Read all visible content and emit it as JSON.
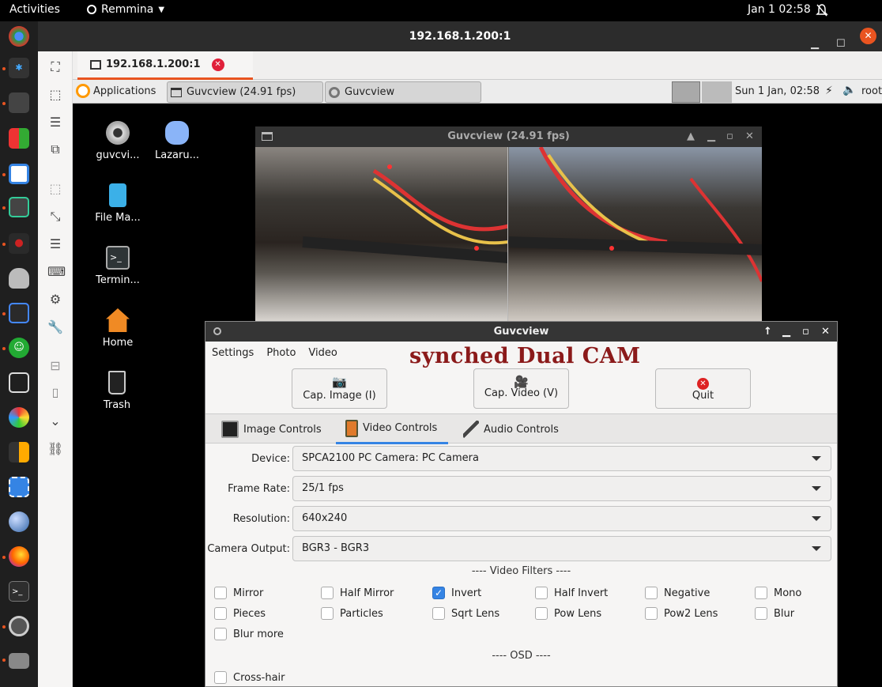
{
  "topbar": {
    "activities": "Activities",
    "app_name": "Remmina",
    "clock": "Jan 1  02:58"
  },
  "remmina": {
    "window_title": "192.168.1.200:1",
    "tab_label": "192.168.1.200:1"
  },
  "xpanel": {
    "applications": "Applications",
    "task1": "Guvcview  (24.91 fps)",
    "task2": "Guvcview",
    "clock": "Sun  1 Jan, 02:58",
    "user": "root"
  },
  "desktop_icons": [
    {
      "label": "guvcvi..."
    },
    {
      "label": "Lazaru..."
    },
    {
      "label": "File Ma..."
    },
    {
      "label": "Termin..."
    },
    {
      "label": "Home"
    },
    {
      "label": "Trash"
    }
  ],
  "video_window": {
    "title": "Guvcview  (24.91 fps)"
  },
  "guvcview": {
    "title": "Guvcview",
    "menu": [
      "Settings",
      "Photo",
      "Video"
    ],
    "overlay_text": "synched Dual CAM",
    "buttons": {
      "cap_image": "Cap. Image (I)",
      "cap_video": "Cap. Video (V)",
      "quit": "Quit"
    },
    "tabs": [
      "Image Controls",
      "Video Controls",
      "Audio Controls"
    ],
    "fields": [
      {
        "label": "Device:",
        "value": "SPCA2100 PC Camera: PC Camera"
      },
      {
        "label": "Frame Rate:",
        "value": "25/1 fps"
      },
      {
        "label": "Resolution:",
        "value": "640x240"
      },
      {
        "label": "Camera Output:",
        "value": "BGR3 - BGR3"
      }
    ],
    "video_filters_header": "---- Video Filters ----",
    "filters": [
      {
        "label": "Mirror",
        "checked": false
      },
      {
        "label": "Half Mirror",
        "checked": false
      },
      {
        "label": "Invert",
        "checked": true
      },
      {
        "label": "Half Invert",
        "checked": false
      },
      {
        "label": "Negative",
        "checked": false
      },
      {
        "label": "Mono",
        "checked": false
      },
      {
        "label": "Pieces",
        "checked": false
      },
      {
        "label": "Particles",
        "checked": false
      },
      {
        "label": "Sqrt Lens",
        "checked": false
      },
      {
        "label": "Pow Lens",
        "checked": false
      },
      {
        "label": "Pow2 Lens",
        "checked": false
      },
      {
        "label": "Blur",
        "checked": false
      },
      {
        "label": "Blur more",
        "checked": false
      }
    ],
    "osd_header": "---- OSD ----",
    "osd": [
      {
        "label": "Cross-hair",
        "checked": false
      }
    ]
  },
  "colors": {
    "ubuntu_orange": "#e95420",
    "overlay_text": "#8b1a1a",
    "checkbox_on": "#3584e4"
  }
}
